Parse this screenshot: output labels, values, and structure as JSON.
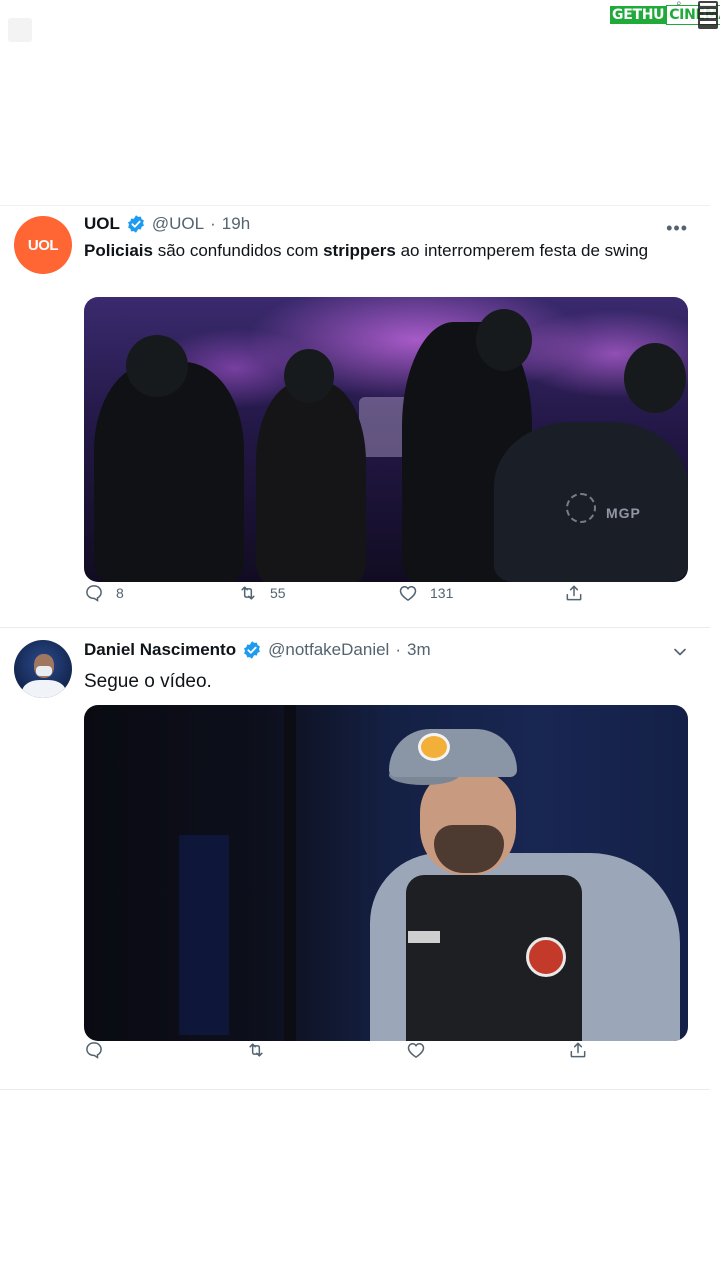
{
  "watermark": {
    "part1": "GETHU",
    "part2": "CINEMA"
  },
  "tweets": [
    {
      "avatar_text": "UOL",
      "name": "UOL",
      "handle": "@UOL",
      "separator": "·",
      "time": "19h",
      "text_bold1": "Policiais",
      "text_plain1": " são confundidos com ",
      "text_bold2": "strippers",
      "text_plain2": " ao interromperem festa de swing",
      "media_overlay_text": "MGP",
      "replies": "8",
      "retweets": "55",
      "likes": "131"
    },
    {
      "name": "Daniel Nascimento",
      "handle": "@notfakeDaniel",
      "separator": "·",
      "time": "3m",
      "text": "Segue o vídeo."
    }
  ],
  "colors": {
    "verified_blue": "#1d9bf0",
    "uol_orange": "#ff6633",
    "secondary_text": "#536471"
  }
}
